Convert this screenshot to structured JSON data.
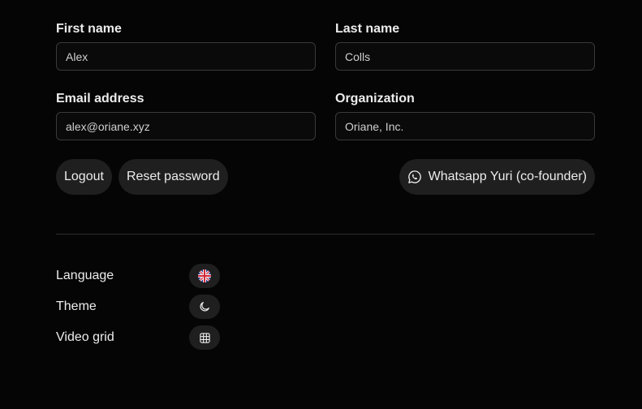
{
  "profile": {
    "first_name": {
      "label": "First name",
      "value": "Alex"
    },
    "last_name": {
      "label": "Last name",
      "value": "Colls"
    },
    "email": {
      "label": "Email address",
      "value": "alex@oriane.xyz"
    },
    "organization": {
      "label": "Organization",
      "value": "Oriane, Inc."
    }
  },
  "actions": {
    "logout_label": "Logout",
    "reset_password_label": "Reset password",
    "whatsapp_label": "Whatsapp Yuri (co-founder)",
    "whatsapp_icon": "whatsapp-icon"
  },
  "preferences": {
    "language": {
      "label": "Language",
      "icon": "uk-flag-icon"
    },
    "theme": {
      "label": "Theme",
      "icon": "moon-icon"
    },
    "video_grid": {
      "label": "Video grid",
      "icon": "grid-icon"
    }
  },
  "colors": {
    "background": "#050505",
    "button_bg": "#1f1f1f",
    "input_border": "#3a3a3a",
    "text": "#ececec"
  }
}
